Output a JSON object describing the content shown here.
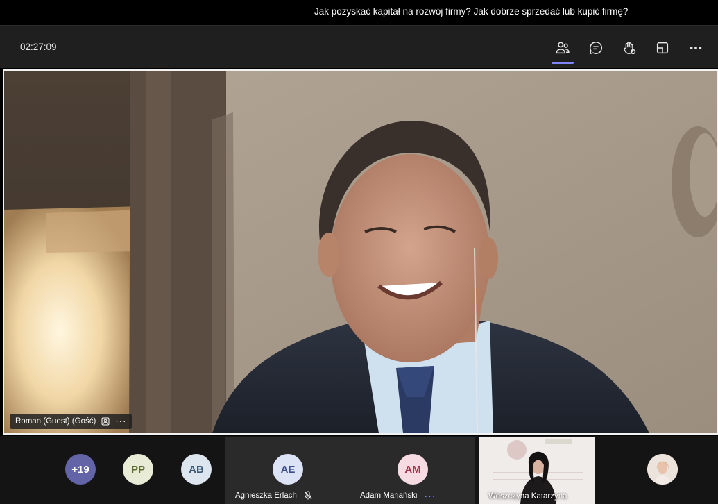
{
  "window": {
    "title": "Jak pozyskać kapitał na rozwój firmy? Jak dobrze sprzedać lub kupić firmę?"
  },
  "toolbar": {
    "timer": "02:27:09",
    "buttons": [
      {
        "name": "participants",
        "icon": "people-icon",
        "active": true
      },
      {
        "name": "chat",
        "icon": "chat-icon",
        "active": false
      },
      {
        "name": "raise-hand",
        "icon": "raise-hand-icon",
        "active": false
      },
      {
        "name": "share",
        "icon": "share-tray-icon",
        "active": false
      },
      {
        "name": "more",
        "icon": "more-icon",
        "active": false
      }
    ]
  },
  "main_video": {
    "participant": "Roman (Guest) (Gość)",
    "tag_icon": "guest-badge-icon",
    "more_label": "···"
  },
  "gallery": {
    "overflow": {
      "label": "+19",
      "color": "#6264a7"
    },
    "avatars": [
      {
        "initials": "PP",
        "bg": "#e8ecd7",
        "fg": "#5b6b2e"
      },
      {
        "initials": "AB",
        "bg": "#dde6ee",
        "fg": "#3d5a74"
      }
    ],
    "tiles": [
      {
        "initials": "AE",
        "name": "Agnieszka Erlach",
        "bg": "#dbe3f5",
        "fg": "#3b4f86",
        "muted": true
      },
      {
        "initials": "AM",
        "name": "Adam Mariański",
        "bg": "#f6dbe2",
        "fg": "#a3344e",
        "more": "···"
      }
    ],
    "video_tile": {
      "name": "Woszczyna Katarzyna"
    },
    "photo_participant": {
      "icon": "profile-photo-icon"
    }
  },
  "colors": {
    "accent": "#7f85f5",
    "toolbar_bg": "#1f1f1f",
    "gallery_bg": "#141414"
  }
}
